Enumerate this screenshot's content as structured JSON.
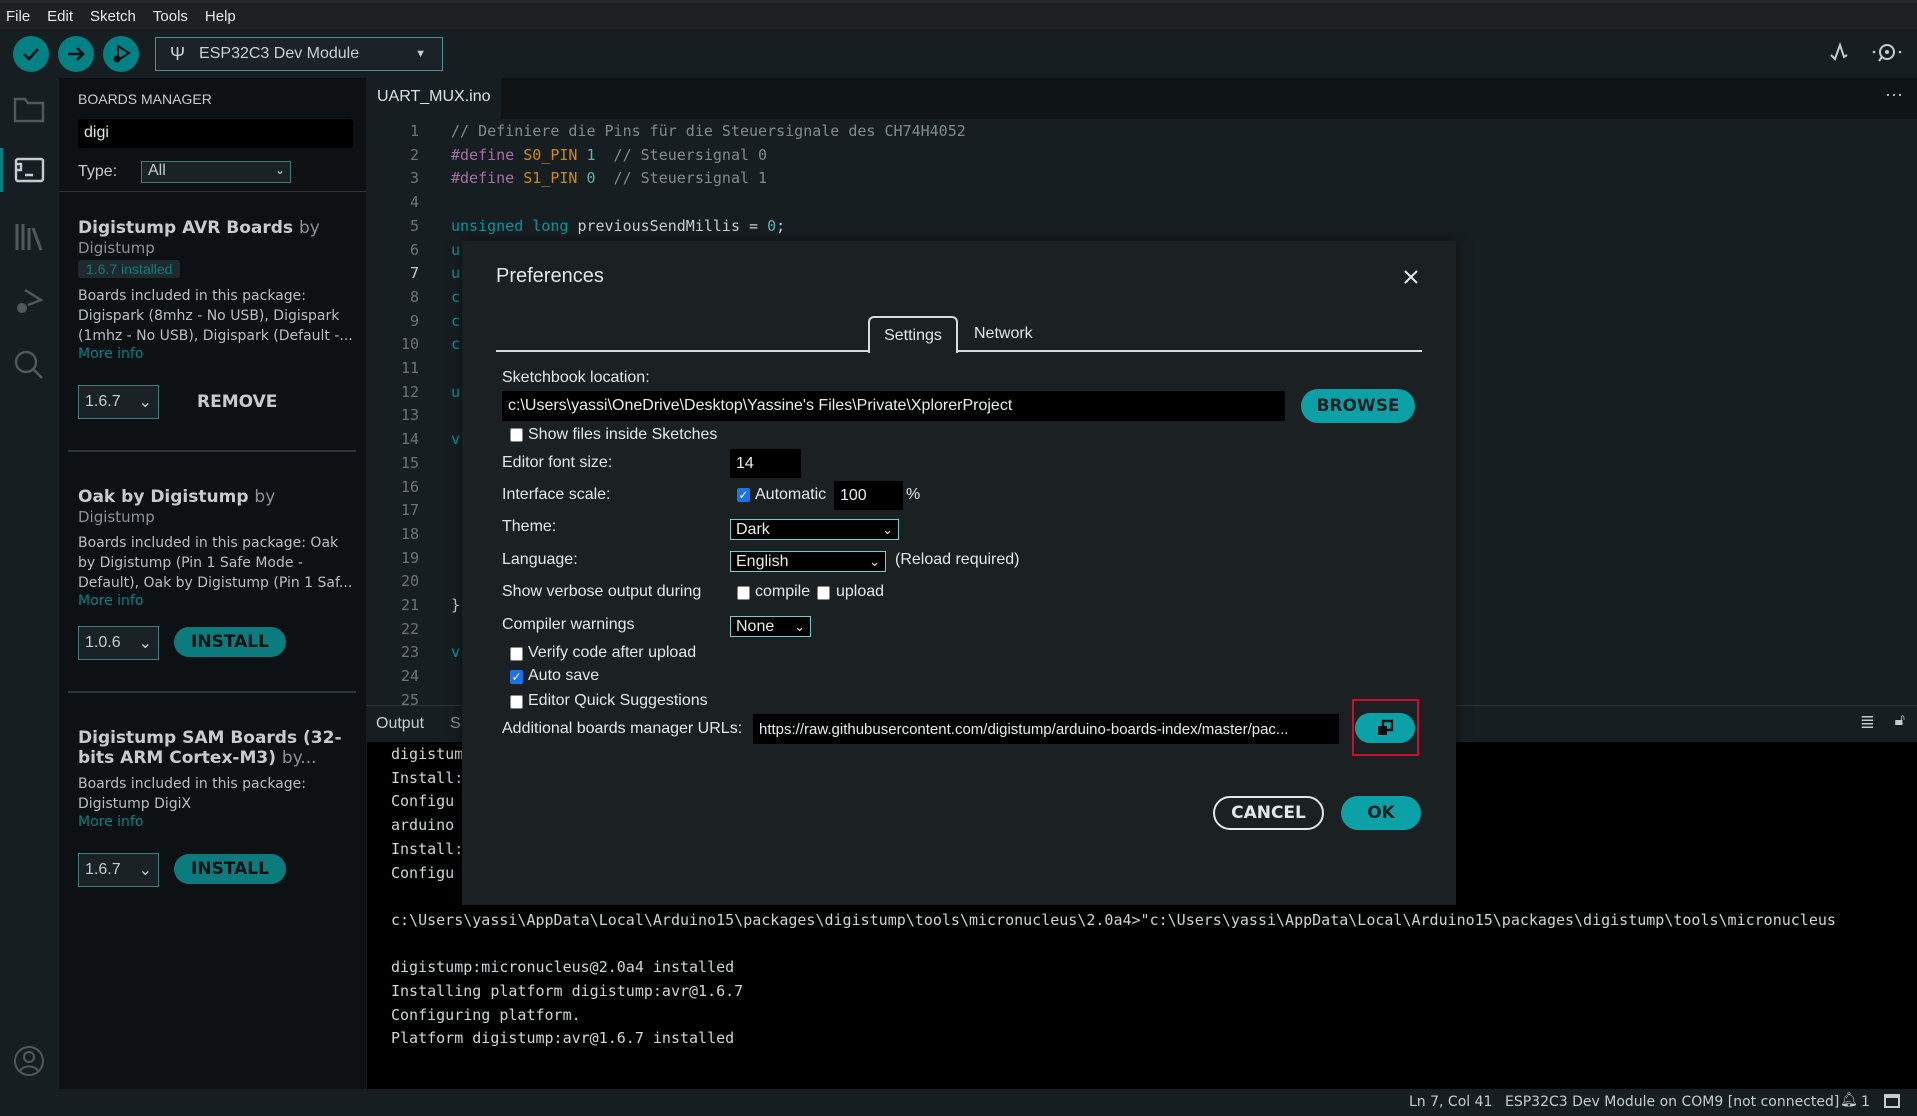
{
  "menu": [
    "File",
    "Edit",
    "Sketch",
    "Tools",
    "Help"
  ],
  "toolbar": {
    "board": "ESP32C3 Dev Module",
    "verify_icon": "check-icon",
    "upload_icon": "arrow-right-icon",
    "debug_icon": "debug-icon"
  },
  "sidebar": {
    "header": "BOARDS MANAGER",
    "search_value": "digi",
    "type_label": "Type:",
    "type_value": "All",
    "boards": [
      {
        "title": "Digistump AVR Boards",
        "by": "by",
        "author": "Digistump",
        "badge": "1.6.7 installed",
        "desc": [
          "Boards included in this package:",
          "Digispark (8mhz - No USB), Digispark",
          "(1mhz - No USB), Digispark (Default -..."
        ],
        "more": "More info",
        "version": "1.6.7",
        "action": "REMOVE"
      },
      {
        "title": "Oak by Digistump",
        "by": "by",
        "author": "Digistump",
        "desc": [
          "Boards included in this package: Oak",
          "by Digistump (Pin 1 Safe Mode -",
          "Default), Oak by Digistump (Pin 1 Saf..."
        ],
        "more": "More info",
        "version": "1.0.6",
        "action": "INSTALL"
      },
      {
        "title_lines": [
          "Digistump SAM Boards (32-",
          "bits ARM Cortex-M3)"
        ],
        "by": "by...",
        "desc": [
          "Boards included in this package:",
          "Digistump DigiX"
        ],
        "more": "More info",
        "version": "1.6.7",
        "action": "INSTALL"
      }
    ]
  },
  "editor": {
    "tab": "UART_MUX.ino",
    "lines": [
      {
        "n": "1",
        "parts": [
          [
            "cm",
            "// Definiere die Pins für die Steuersignale des CH74H4052"
          ]
        ]
      },
      {
        "n": "2",
        "parts": [
          [
            "kw",
            "#define "
          ],
          [
            "mc",
            "S0_PIN "
          ],
          [
            "nu",
            "1"
          ],
          [
            "cm",
            "  // Steuersignal 0"
          ]
        ]
      },
      {
        "n": "3",
        "parts": [
          [
            "kw",
            "#define "
          ],
          [
            "mc",
            "S1_PIN "
          ],
          [
            "nu",
            "0"
          ],
          [
            "cm",
            "  // Steuersignal 1"
          ]
        ]
      },
      {
        "n": "4",
        "parts": []
      },
      {
        "n": "5",
        "parts": [
          [
            "ty",
            "unsigned long "
          ],
          [
            "",
            "previousSendMillis = "
          ],
          [
            "nu",
            "0"
          ],
          [
            "",
            ";"
          ]
        ]
      },
      {
        "n": "6",
        "parts": [
          [
            "ty",
            "u"
          ]
        ]
      },
      {
        "n": "7",
        "parts": [
          [
            "ty",
            "u"
          ]
        ]
      },
      {
        "n": "8",
        "parts": [
          [
            "ty",
            "c"
          ]
        ]
      },
      {
        "n": "9",
        "parts": [
          [
            "ty",
            "c"
          ]
        ]
      },
      {
        "n": "10",
        "parts": [
          [
            "ty",
            "c"
          ]
        ]
      },
      {
        "n": "11",
        "parts": []
      },
      {
        "n": "12",
        "parts": [
          [
            "ty",
            "u"
          ]
        ]
      },
      {
        "n": "13",
        "parts": []
      },
      {
        "n": "14",
        "parts": [
          [
            "ty",
            "v"
          ]
        ]
      },
      {
        "n": "15",
        "parts": []
      },
      {
        "n": "16",
        "parts": []
      },
      {
        "n": "17",
        "parts": []
      },
      {
        "n": "18",
        "parts": []
      },
      {
        "n": "19",
        "parts": []
      },
      {
        "n": "20",
        "parts": []
      },
      {
        "n": "21",
        "parts": [
          [
            "",
            "}"
          ]
        ]
      },
      {
        "n": "22",
        "parts": []
      },
      {
        "n": "23",
        "parts": [
          [
            "ty",
            "v"
          ]
        ]
      },
      {
        "n": "24",
        "parts": []
      },
      {
        "n": "25",
        "parts": []
      }
    ]
  },
  "output": {
    "tab": "Output",
    "tab2": "S",
    "lines": [
      "digistum",
      "Install:",
      "Configu",
      "arduino",
      "Install:",
      "Configu",
      "",
      "c:\\Users\\yassi\\AppData\\Local\\Arduino15\\packages\\digistump\\tools\\micronucleus\\2.0a4>\"c:\\Users\\yassi\\AppData\\Local\\Arduino15\\packages\\digistump\\tools\\micronucleus",
      "",
      "digistump:micronucleus@2.0a4 installed",
      "Installing platform digistump:avr@1.6.7",
      "Configuring platform.",
      "Platform digistump:avr@1.6.7 installed"
    ]
  },
  "status": {
    "position": "Ln 7, Col 41",
    "board": "ESP32C3 Dev Module on COM9 [not connected]",
    "notifications": "1"
  },
  "dialog": {
    "title": "Preferences",
    "tabs": [
      "Settings",
      "Network"
    ],
    "sketchbook_label": "Sketchbook location:",
    "sketchbook_value": "c:\\Users\\yassi\\OneDrive\\Desktop\\Yassine's Files\\Private\\XplorerProject",
    "browse": "BROWSE",
    "show_files": "Show files inside Sketches",
    "font_size_label": "Editor font size:",
    "font_size": "14",
    "scale_label": "Interface scale:",
    "automatic": "Automatic",
    "scale_value": "100",
    "percent": "%",
    "theme_label": "Theme:",
    "theme": "Dark",
    "language_label": "Language:",
    "language": "English",
    "reload": "(Reload required)",
    "verbose_label": "Show verbose output during",
    "compile": "compile",
    "upload": "upload",
    "warnings_label": "Compiler warnings",
    "warnings": "None",
    "verify": "Verify code after upload",
    "autosave": "Auto save",
    "quick": "Editor Quick Suggestions",
    "urls_label": "Additional boards manager URLs:",
    "urls_value": "https://raw.githubusercontent.com/digistump/arduino-boards-index/master/pac...",
    "cancel": "CANCEL",
    "ok": "OK",
    "checks": {
      "show_files": false,
      "automatic": true,
      "compile": false,
      "upload": false,
      "verify": false,
      "autosave": true,
      "quick": false
    },
    "highlight_color": "#c8102e",
    "accent": "#0ca1a6"
  }
}
